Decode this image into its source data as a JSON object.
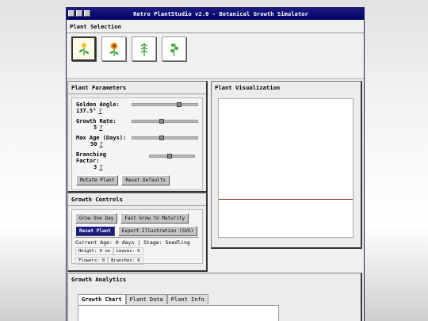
{
  "window": {
    "title": "Retro PlantStudio v2.0 - Botanical Growth Simulator"
  },
  "selection": {
    "heading": "Plant Selection",
    "plants": [
      {
        "icon": "sprout-icon",
        "selected": true
      },
      {
        "icon": "sunflower-icon",
        "selected": false
      },
      {
        "icon": "fern-icon",
        "selected": false
      },
      {
        "icon": "vine-icon",
        "selected": false
      }
    ]
  },
  "params": {
    "heading": "Plant Parameters",
    "golden_angle": {
      "label": "Golden Angle:",
      "value": "137.5°",
      "help": "?",
      "level": 0.72
    },
    "growth_rate": {
      "label": "Growth Rate:",
      "value": "5",
      "help": "?",
      "level": 0.45
    },
    "max_age": {
      "label": "Max Age (Days):",
      "value": "50",
      "help": "?",
      "level": 0.45
    },
    "branching": {
      "label": "Branching Factor:",
      "value": "3",
      "help": "?",
      "level": 0.45
    },
    "mutate_label": "Mutate Plant",
    "reset_defaults_label": "Reset Defaults"
  },
  "controls": {
    "heading": "Growth Controls",
    "grow_one_day": "Grow One Day",
    "fast_grow": "Fast Grow to Maturity",
    "reset_plant": "Reset Plant",
    "export": "Export Illustration (SVG)",
    "status": "Current Age: 0 days | Stage: Seedling",
    "height": "Height: 0 cm",
    "leaves": "Leaves: 0",
    "flowers": "Flowers: 0",
    "branches": "Branches: 0"
  },
  "viz": {
    "heading": "Plant Visualization"
  },
  "analytics": {
    "heading": "Growth Analytics",
    "tabs": [
      "Growth Chart",
      "Plant Data",
      "Plant Info"
    ]
  },
  "colors": {
    "title_bar": "#000066",
    "ground_line": "#8b3a1f",
    "accent_button": "#1c1c80"
  }
}
